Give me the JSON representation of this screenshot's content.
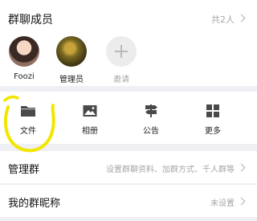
{
  "members": {
    "title": "群聊成员",
    "count": "共2人",
    "list": [
      {
        "name": "Foozi"
      },
      {
        "name": "管理员"
      },
      {
        "name": "邀请"
      }
    ]
  },
  "actions": [
    {
      "label": "文件",
      "icon": "folder-icon"
    },
    {
      "label": "相册",
      "icon": "image-icon"
    },
    {
      "label": "公告",
      "icon": "signpost-icon"
    },
    {
      "label": "更多",
      "icon": "grid-icon"
    }
  ],
  "rows": {
    "manage": {
      "title": "管理群",
      "value": "设置群聊资料、加群方式、千人群等"
    },
    "nickname": {
      "title": "我的群昵称",
      "value": "未设置"
    }
  },
  "colors": {
    "annotation": "#f2e600",
    "muted_text": "#a6a6a6",
    "icon": "#4a4a4a"
  }
}
